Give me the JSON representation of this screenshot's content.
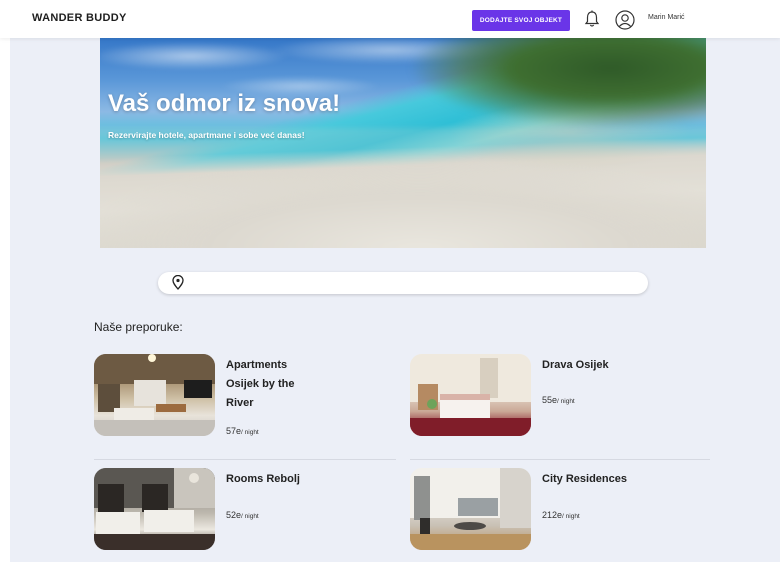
{
  "header": {
    "logo": "WANDER BUDDY",
    "add_property_label": "DODAJTE SVOJ OBJEKT",
    "user_name": "Marin Marić"
  },
  "hero": {
    "title": "Vaš odmor iz snova!",
    "subtitle": "Rezervirajte hotele, apartmane i sobe već danas!"
  },
  "search": {
    "value": ""
  },
  "recommendations": {
    "title": "Naše preporuke:",
    "items": [
      {
        "name": "Apartments Osijek by the River",
        "price": "57e",
        "unit": "/ night"
      },
      {
        "name": "Drava Osijek",
        "price": "55e",
        "unit": "/ night"
      },
      {
        "name": "Rooms Rebolj",
        "price": "52e",
        "unit": "/ night"
      },
      {
        "name": "City Residences",
        "price": "212e",
        "unit": "/ night"
      }
    ]
  },
  "colors": {
    "accent": "#6a35e8",
    "page_background": "#eceff7"
  },
  "icons": [
    "bell-icon",
    "user-avatar-icon",
    "location-pin-icon"
  ]
}
